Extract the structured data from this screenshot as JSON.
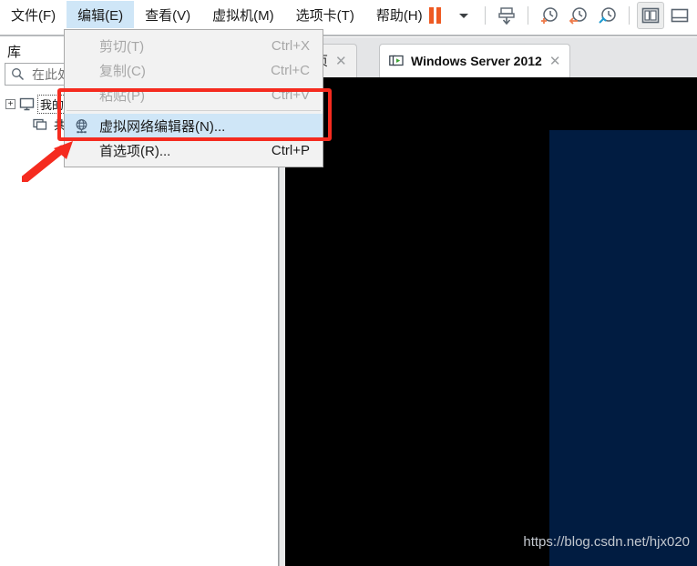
{
  "menubar": {
    "items": [
      {
        "label": "文件(F)",
        "mnemonic": "F",
        "name": "menu-file",
        "active": false
      },
      {
        "label": "编辑(E)",
        "mnemonic": "E",
        "name": "menu-edit",
        "active": true
      },
      {
        "label": "查看(V)",
        "mnemonic": "V",
        "name": "menu-view",
        "active": false
      },
      {
        "label": "虚拟机(M)",
        "mnemonic": "M",
        "name": "menu-vm",
        "active": false
      },
      {
        "label": "选项卡(T)",
        "mnemonic": "T",
        "name": "menu-tabs",
        "active": false
      },
      {
        "label": "帮助(H)",
        "mnemonic": "H",
        "name": "menu-help",
        "active": false
      }
    ]
  },
  "toolbar": {
    "buttons": [
      {
        "icon": "pause-icon",
        "name": "suspend-button"
      },
      {
        "icon": "chevron-down-icon",
        "name": "power-dropdown-button"
      },
      {
        "icon": "manage-vm-icon",
        "name": "manage-vm-button"
      },
      {
        "icon": "snapshot-add-icon",
        "name": "take-snapshot-button"
      },
      {
        "icon": "snapshot-revert-icon",
        "name": "revert-snapshot-button"
      },
      {
        "icon": "snapshot-manager-icon",
        "name": "snapshot-manager-button"
      },
      {
        "icon": "show-library-icon",
        "name": "show-library-button"
      },
      {
        "icon": "show-console-icon",
        "name": "show-console-view-button"
      }
    ]
  },
  "dropdown": {
    "owner": "编辑(E)",
    "items": [
      {
        "label": "剪切(T)",
        "accel": "Ctrl+X",
        "state": "disabled",
        "icon": "",
        "name": "menu-item-cut"
      },
      {
        "label": "复制(C)",
        "accel": "Ctrl+C",
        "state": "disabled",
        "icon": "",
        "name": "menu-item-copy"
      },
      {
        "label": "粘贴(P)",
        "accel": "Ctrl+V",
        "state": "disabled",
        "icon": "",
        "name": "menu-item-paste"
      },
      {
        "label": "虚拟网络编辑器(N)...",
        "accel": "",
        "state": "highlight",
        "icon": "globe-icon",
        "name": "menu-item-virtual-network-editor"
      },
      {
        "label": "首选项(R)...",
        "accel": "Ctrl+P",
        "state": "normal",
        "icon": "",
        "name": "menu-item-preferences"
      }
    ]
  },
  "sidebar": {
    "title": "库",
    "search": {
      "placeholder": "在此处键入内容以进行搜索",
      "value": "",
      "icon": "search-icon"
    },
    "tree": [
      {
        "label": "我的计算机",
        "icon": "computer-icon",
        "expander": "+",
        "name": "tree-item-my-computer"
      },
      {
        "label": "共享虚拟机",
        "icon": "shared-vms-icon",
        "expander": "",
        "name": "tree-item-shared-vms"
      }
    ]
  },
  "tabs": [
    {
      "label": "主页",
      "active": false,
      "closable": true,
      "icon": "",
      "name": "tab-home"
    },
    {
      "label": "Windows Server 2012",
      "active": true,
      "closable": true,
      "icon": "vm-running-icon",
      "name": "tab-windows-server-2012"
    }
  ],
  "console": {
    "watermark": "https://blog.csdn.net/hjx020",
    "background": "#000000",
    "panel_color": "#011c41"
  },
  "annotations": {
    "highlight_rect_color": "#f52b1f",
    "arrow_color": "#f52b1f"
  }
}
